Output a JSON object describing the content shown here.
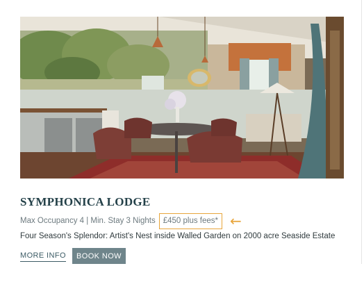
{
  "listing": {
    "title": "SYMPHONICA LODGE",
    "occupancy": "Max Occupancy 4 | Min. Stay 3 Nights",
    "price": "£450 plus fees*",
    "description": "Four Season's Splendor: Artist's Nest inside Walled Garden on 2000 acre Seaside Estate",
    "more_info_label": "MORE INFO",
    "book_now_label": "BOOK NOW"
  },
  "annotation": {
    "arrow_icon": "left-arrow-icon",
    "highlight_color": "#e8a53b"
  },
  "colors": {
    "title": "#244149",
    "button_bg": "#6f858b",
    "link": "#3d5c66"
  }
}
